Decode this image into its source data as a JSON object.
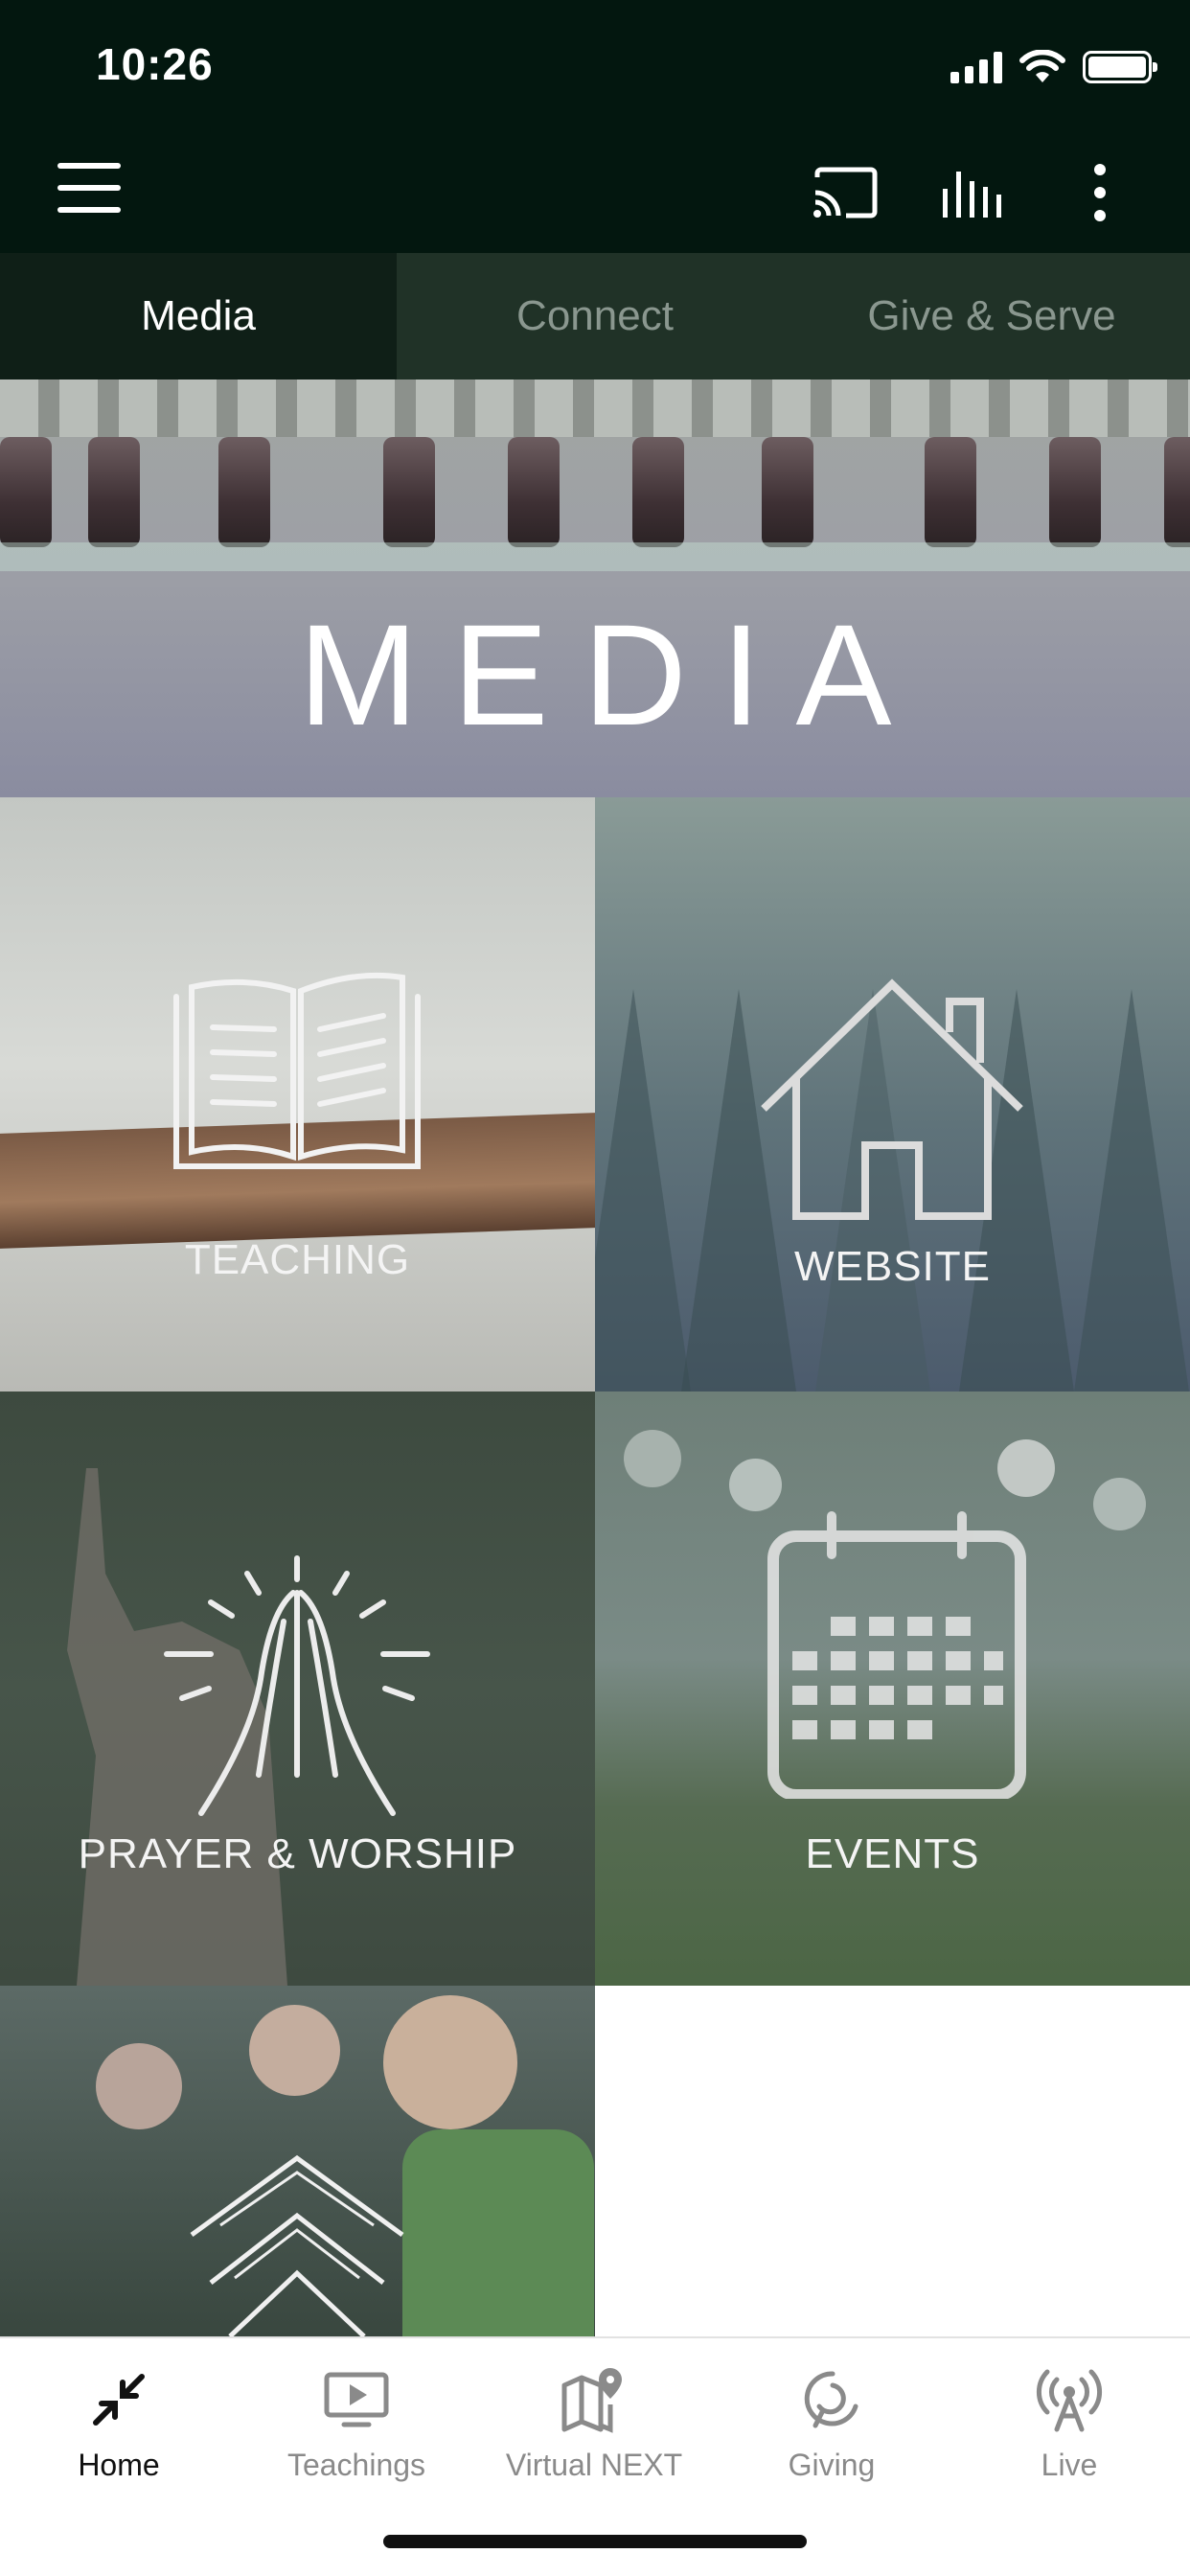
{
  "status_bar": {
    "time": "10:26"
  },
  "header": {
    "menu_icon": "hamburger-menu-icon",
    "actions": [
      "cast-icon",
      "audio-bars-icon",
      "more-vertical-icon"
    ]
  },
  "tabs": [
    {
      "label": "Media",
      "active": true
    },
    {
      "label": "Connect",
      "active": false
    },
    {
      "label": "Give & Serve",
      "active": false
    }
  ],
  "banner": {
    "title": "MEDIA"
  },
  "tiles": [
    {
      "label": "TEACHING",
      "icon": "open-book-icon"
    },
    {
      "label": "WEBSITE",
      "icon": "house-icon"
    },
    {
      "label": "PRAYER & WORSHIP",
      "icon": "praying-hands-icon"
    },
    {
      "label": "EVENTS",
      "icon": "calendar-icon"
    },
    {
      "label": "",
      "icon": "arrows-up-icon"
    }
  ],
  "bottom_nav": [
    {
      "label": "Home",
      "icon": "home-arrows-icon",
      "active": true
    },
    {
      "label": "Teachings",
      "icon": "play-screen-icon",
      "active": false
    },
    {
      "label": "Virtual NEXT",
      "icon": "map-pin-icon",
      "active": false
    },
    {
      "label": "Giving",
      "icon": "giving-hand-icon",
      "active": false
    },
    {
      "label": "Live",
      "icon": "broadcast-icon",
      "active": false
    }
  ],
  "colors": {
    "header_bg": "#03170f",
    "tabs_bg": "#203227",
    "active_tab_bg": "#0f1f17",
    "nav_active": "#111111",
    "nav_inactive": "#8a8a8a"
  }
}
